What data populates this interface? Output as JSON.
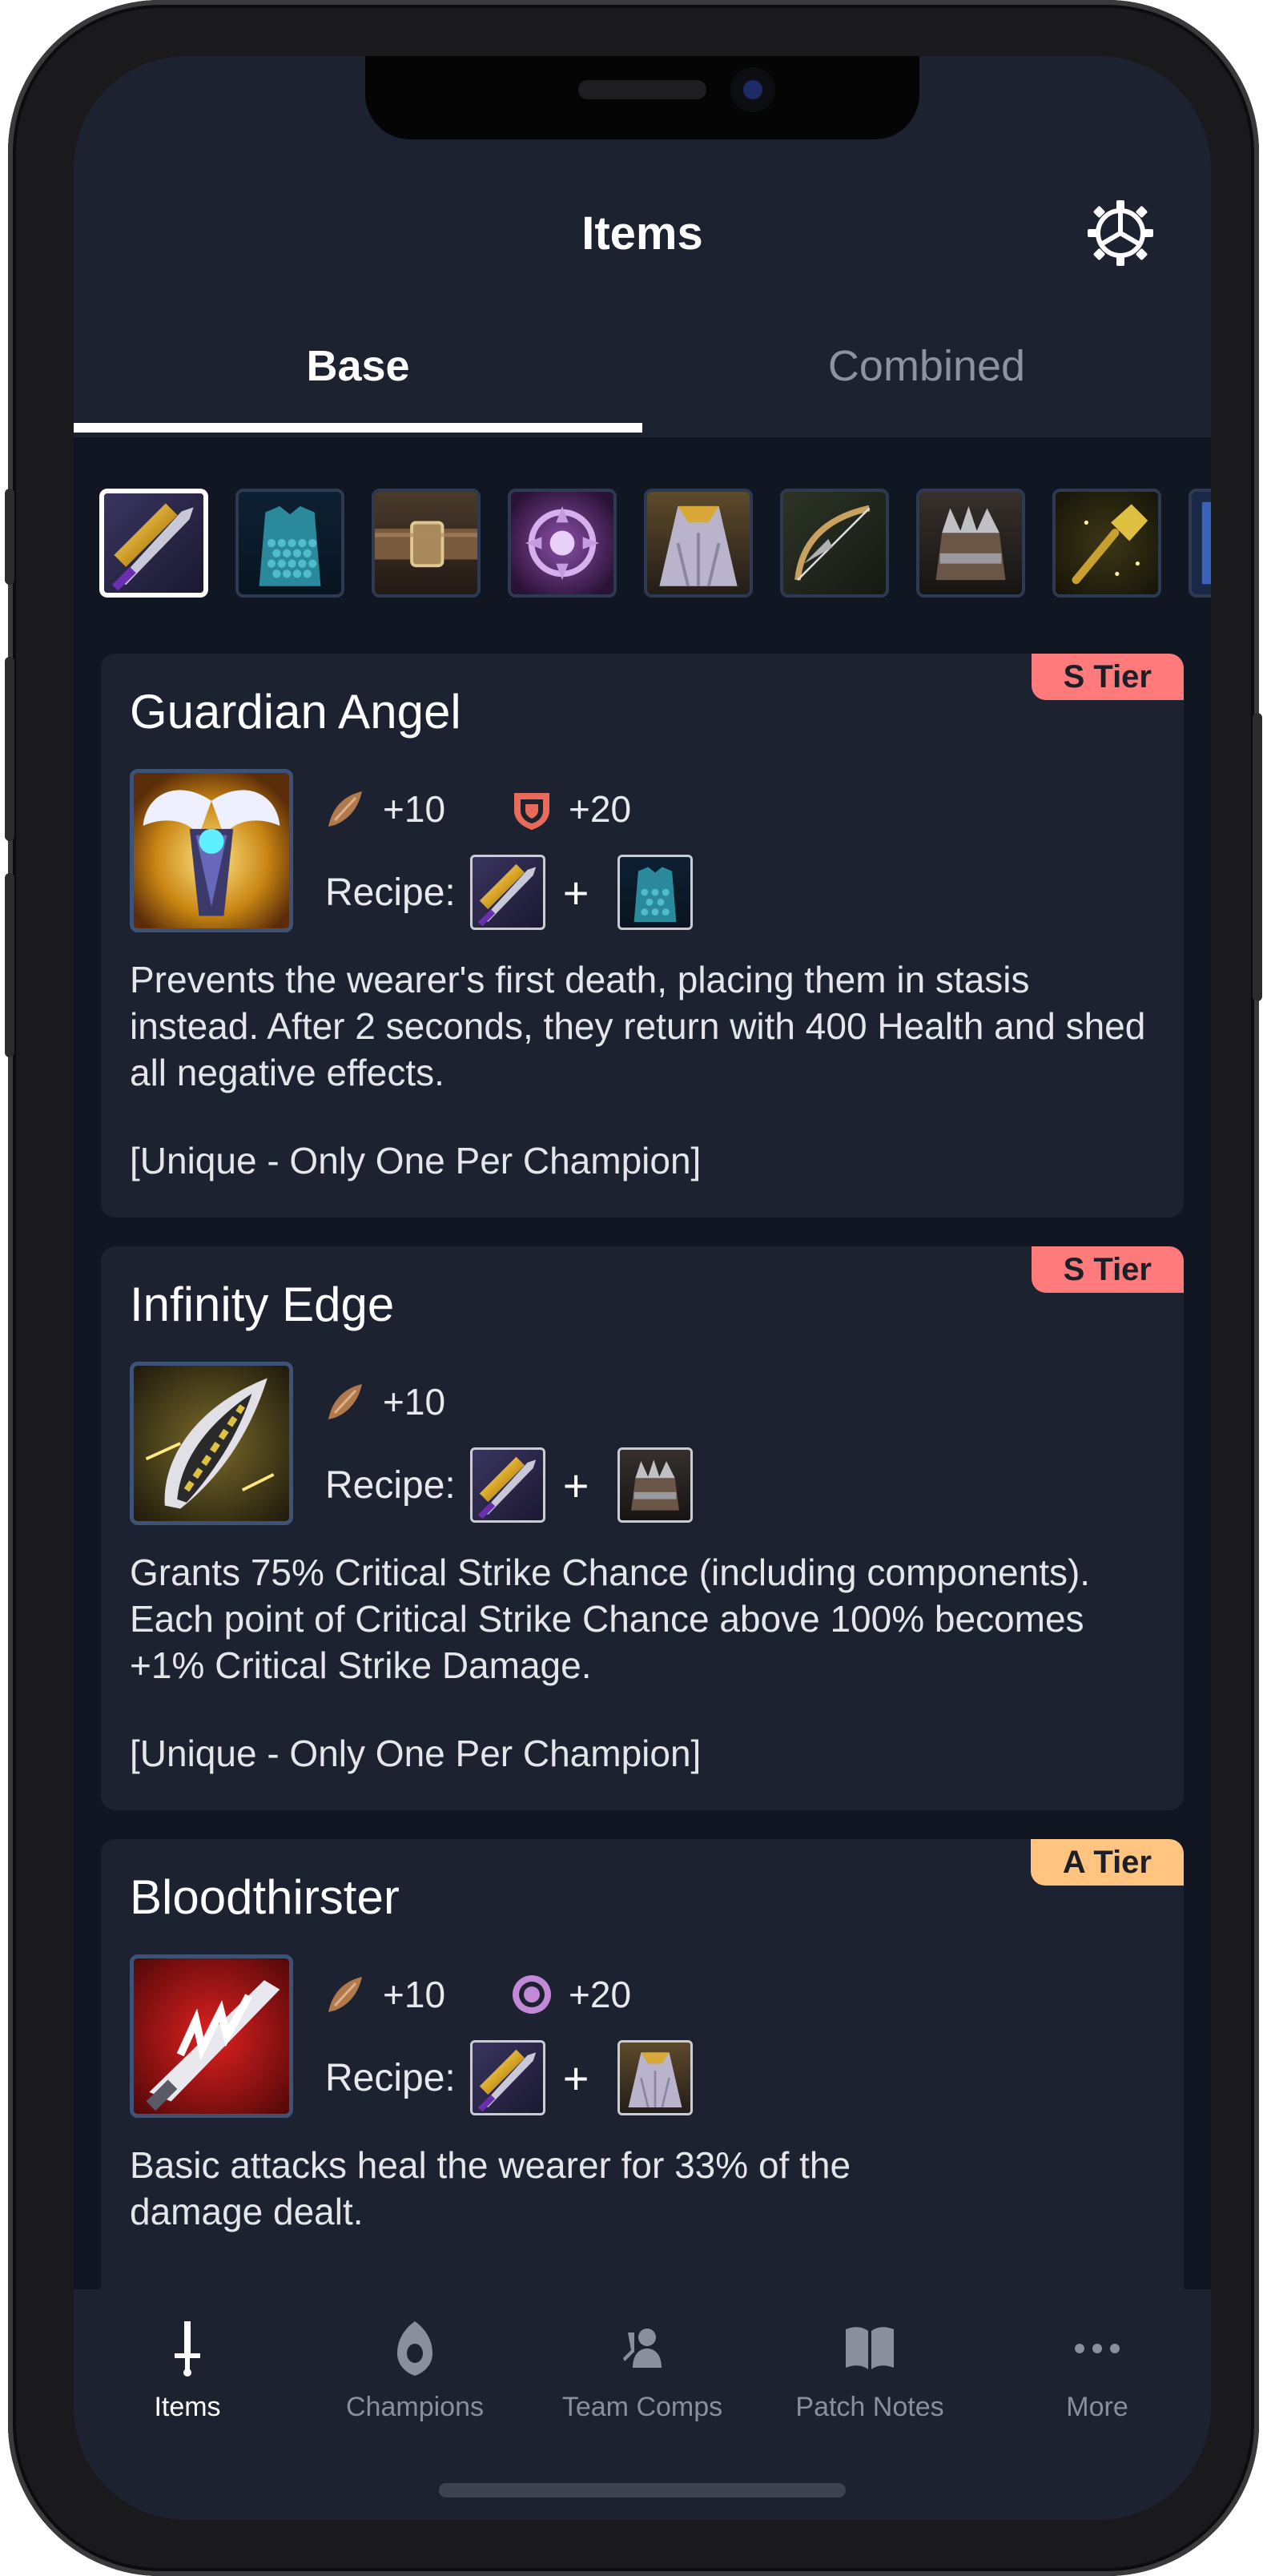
{
  "header": {
    "title": "Items",
    "settings_icon": "gear-icon"
  },
  "tabs": [
    {
      "label": "Base",
      "active": true
    },
    {
      "label": "Combined",
      "active": false
    }
  ],
  "base_items": [
    "sword",
    "chain-vest",
    "giants-belt",
    "negatron-cloak",
    "sparring-gloves",
    "recurve-bow",
    "chain-vest",
    "needlessly-large-rod"
  ],
  "cards": [
    {
      "name": "Guardian Angel",
      "tier": "S Tier",
      "tier_color": "#ff7a7a",
      "stats": [
        {
          "icon": "attack-damage-icon",
          "value": "+10"
        },
        {
          "icon": "armor-icon",
          "value": "+20"
        }
      ],
      "recipe_label": "Recipe:",
      "plus": "+",
      "description": "Prevents the wearer's first death, placing them in stasis instead. After 2 seconds, they return with 400 Health and shed all negative effects.",
      "unique": "[Unique - Only One Per Champion]"
    },
    {
      "name": "Infinity Edge",
      "tier": "S Tier",
      "tier_color": "#ff7a7a",
      "stats": [
        {
          "icon": "attack-damage-icon",
          "value": "+10"
        }
      ],
      "recipe_label": "Recipe:",
      "plus": "+",
      "description": "Grants 75% Critical Strike Chance (including components). Each point of Critical Strike Chance above 100% becomes +1% Critical Strike Damage.",
      "unique": "[Unique - Only One Per Champion]"
    },
    {
      "name": "Bloodthirster",
      "tier": "A Tier",
      "tier_color": "#ffc480",
      "stats": [
        {
          "icon": "attack-damage-icon",
          "value": "+10"
        },
        {
          "icon": "magic-resist-icon",
          "value": "+20"
        }
      ],
      "recipe_label": "Recipe:",
      "plus": "+",
      "description": "Basic attacks heal the wearer for 33% of the damage dealt."
    }
  ],
  "tabbar": [
    {
      "label": "Items",
      "icon": "sword-icon",
      "active": true
    },
    {
      "label": "Champions",
      "icon": "champion-icon",
      "active": false
    },
    {
      "label": "Team Comps",
      "icon": "team-icon",
      "active": false
    },
    {
      "label": "Patch Notes",
      "icon": "book-icon",
      "active": false
    },
    {
      "label": "More",
      "icon": "more-icon",
      "active": false
    }
  ],
  "colors": {
    "accent_active": "#ffffff",
    "background": "#111722",
    "panel": "#1d2230"
  }
}
